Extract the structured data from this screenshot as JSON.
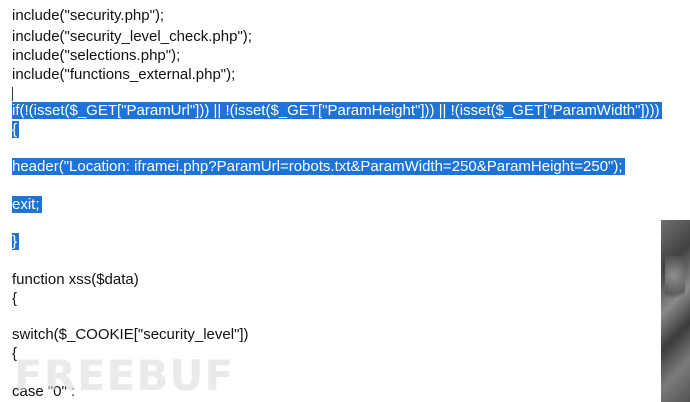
{
  "code": {
    "lines": [
      "include(\"security.php\");",
      "include(\"security_level_check.php\");",
      "include(\"selections.php\");",
      "include(\"functions_external.php\");",
      "if(!(isset($_GET[\"ParamUrl\"])) || !(isset($_GET[\"ParamHeight\"])) || !(isset($_GET[\"ParamWidth\"])))",
      "{",
      "    header(\"Location: iframei.php?ParamUrl=robots.txt&ParamWidth=250&ParamHeight=250\");",
      "    exit;",
      "}",
      "function xss($data)",
      "{",
      "    switch($_COOKIE[\"security_level\"])",
      "    {",
      "        case \"0\" :"
    ]
  },
  "watermark": {
    "text": "FREEBUF"
  },
  "colors": {
    "selection": "#1e73d8",
    "text": "#111111",
    "background": "#ffffff"
  }
}
